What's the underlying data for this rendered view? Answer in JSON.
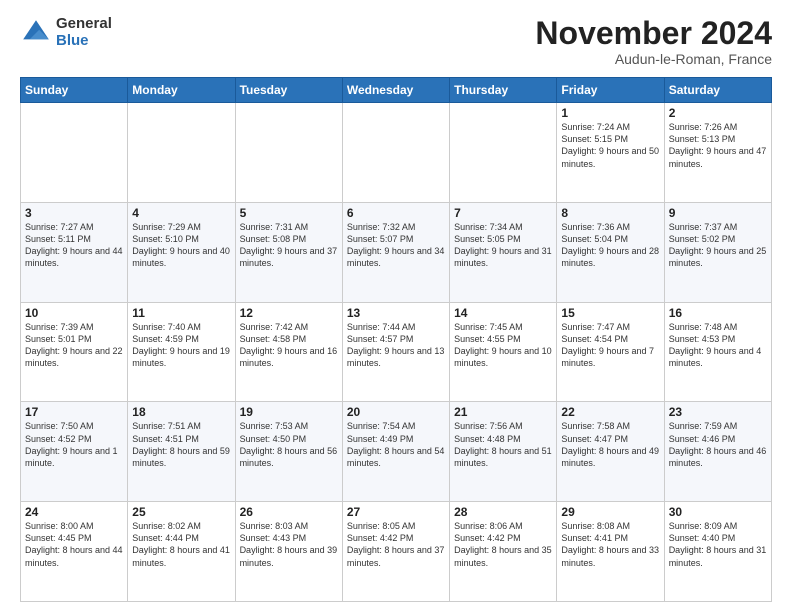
{
  "header": {
    "logo_general": "General",
    "logo_blue": "Blue",
    "month_title": "November 2024",
    "subtitle": "Audun-le-Roman, France"
  },
  "days_of_week": [
    "Sunday",
    "Monday",
    "Tuesday",
    "Wednesday",
    "Thursday",
    "Friday",
    "Saturday"
  ],
  "weeks": [
    [
      {
        "day": "",
        "info": ""
      },
      {
        "day": "",
        "info": ""
      },
      {
        "day": "",
        "info": ""
      },
      {
        "day": "",
        "info": ""
      },
      {
        "day": "",
        "info": ""
      },
      {
        "day": "1",
        "info": "Sunrise: 7:24 AM\nSunset: 5:15 PM\nDaylight: 9 hours and 50 minutes."
      },
      {
        "day": "2",
        "info": "Sunrise: 7:26 AM\nSunset: 5:13 PM\nDaylight: 9 hours and 47 minutes."
      }
    ],
    [
      {
        "day": "3",
        "info": "Sunrise: 7:27 AM\nSunset: 5:11 PM\nDaylight: 9 hours and 44 minutes."
      },
      {
        "day": "4",
        "info": "Sunrise: 7:29 AM\nSunset: 5:10 PM\nDaylight: 9 hours and 40 minutes."
      },
      {
        "day": "5",
        "info": "Sunrise: 7:31 AM\nSunset: 5:08 PM\nDaylight: 9 hours and 37 minutes."
      },
      {
        "day": "6",
        "info": "Sunrise: 7:32 AM\nSunset: 5:07 PM\nDaylight: 9 hours and 34 minutes."
      },
      {
        "day": "7",
        "info": "Sunrise: 7:34 AM\nSunset: 5:05 PM\nDaylight: 9 hours and 31 minutes."
      },
      {
        "day": "8",
        "info": "Sunrise: 7:36 AM\nSunset: 5:04 PM\nDaylight: 9 hours and 28 minutes."
      },
      {
        "day": "9",
        "info": "Sunrise: 7:37 AM\nSunset: 5:02 PM\nDaylight: 9 hours and 25 minutes."
      }
    ],
    [
      {
        "day": "10",
        "info": "Sunrise: 7:39 AM\nSunset: 5:01 PM\nDaylight: 9 hours and 22 minutes."
      },
      {
        "day": "11",
        "info": "Sunrise: 7:40 AM\nSunset: 4:59 PM\nDaylight: 9 hours and 19 minutes."
      },
      {
        "day": "12",
        "info": "Sunrise: 7:42 AM\nSunset: 4:58 PM\nDaylight: 9 hours and 16 minutes."
      },
      {
        "day": "13",
        "info": "Sunrise: 7:44 AM\nSunset: 4:57 PM\nDaylight: 9 hours and 13 minutes."
      },
      {
        "day": "14",
        "info": "Sunrise: 7:45 AM\nSunset: 4:55 PM\nDaylight: 9 hours and 10 minutes."
      },
      {
        "day": "15",
        "info": "Sunrise: 7:47 AM\nSunset: 4:54 PM\nDaylight: 9 hours and 7 minutes."
      },
      {
        "day": "16",
        "info": "Sunrise: 7:48 AM\nSunset: 4:53 PM\nDaylight: 9 hours and 4 minutes."
      }
    ],
    [
      {
        "day": "17",
        "info": "Sunrise: 7:50 AM\nSunset: 4:52 PM\nDaylight: 9 hours and 1 minute."
      },
      {
        "day": "18",
        "info": "Sunrise: 7:51 AM\nSunset: 4:51 PM\nDaylight: 8 hours and 59 minutes."
      },
      {
        "day": "19",
        "info": "Sunrise: 7:53 AM\nSunset: 4:50 PM\nDaylight: 8 hours and 56 minutes."
      },
      {
        "day": "20",
        "info": "Sunrise: 7:54 AM\nSunset: 4:49 PM\nDaylight: 8 hours and 54 minutes."
      },
      {
        "day": "21",
        "info": "Sunrise: 7:56 AM\nSunset: 4:48 PM\nDaylight: 8 hours and 51 minutes."
      },
      {
        "day": "22",
        "info": "Sunrise: 7:58 AM\nSunset: 4:47 PM\nDaylight: 8 hours and 49 minutes."
      },
      {
        "day": "23",
        "info": "Sunrise: 7:59 AM\nSunset: 4:46 PM\nDaylight: 8 hours and 46 minutes."
      }
    ],
    [
      {
        "day": "24",
        "info": "Sunrise: 8:00 AM\nSunset: 4:45 PM\nDaylight: 8 hours and 44 minutes."
      },
      {
        "day": "25",
        "info": "Sunrise: 8:02 AM\nSunset: 4:44 PM\nDaylight: 8 hours and 41 minutes."
      },
      {
        "day": "26",
        "info": "Sunrise: 8:03 AM\nSunset: 4:43 PM\nDaylight: 8 hours and 39 minutes."
      },
      {
        "day": "27",
        "info": "Sunrise: 8:05 AM\nSunset: 4:42 PM\nDaylight: 8 hours and 37 minutes."
      },
      {
        "day": "28",
        "info": "Sunrise: 8:06 AM\nSunset: 4:42 PM\nDaylight: 8 hours and 35 minutes."
      },
      {
        "day": "29",
        "info": "Sunrise: 8:08 AM\nSunset: 4:41 PM\nDaylight: 8 hours and 33 minutes."
      },
      {
        "day": "30",
        "info": "Sunrise: 8:09 AM\nSunset: 4:40 PM\nDaylight: 8 hours and 31 minutes."
      }
    ]
  ]
}
